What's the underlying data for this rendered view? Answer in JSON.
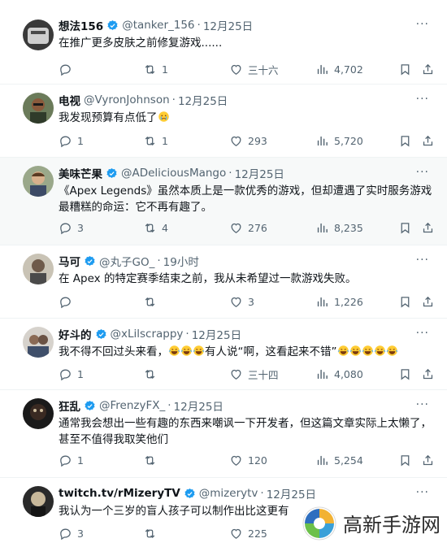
{
  "tweets": [
    {
      "name": "想法156",
      "handle": "@tanker_156",
      "time": "12月25日",
      "text": "在推广更多皮肤之前修复游戏......",
      "replies": "",
      "retweets": "1",
      "likes": "三十六",
      "views": "4,702",
      "verified": true
    },
    {
      "name": "电视",
      "handle": "@VyronJohnson",
      "time": "12月25日",
      "text": "我发现预算有点低了",
      "text_emoji": "crying-emoji",
      "replies": "1",
      "retweets": "1",
      "likes": "293",
      "views": "5,720",
      "verified": false
    },
    {
      "name": "美味芒果",
      "handle": "@ADeliciousMango",
      "time": "12月25日",
      "text": "《Apex Legends》虽然本质上是一款优秀的游戏，但却遭遇了实时服务游戏最糟糕的命运：它不再有趣了。",
      "replies": "3",
      "retweets": "4",
      "likes": "276",
      "views": "8,235",
      "verified": true
    },
    {
      "name": "马可",
      "handle": "@丸子GO_",
      "time": "19小时",
      "text": "在 Apex 的特定赛季结束之前，我从未希望过一款游戏失败。",
      "replies": "",
      "retweets": "",
      "likes": "3",
      "views": "1,226",
      "verified": true
    },
    {
      "name": "好斗的",
      "handle": "@xLilscrappy",
      "time": "12月25日",
      "text_parts": [
        "我不得不回过头来看，",
        "有人说“啊，这看起来不错”"
      ],
      "replies": "1",
      "retweets": "",
      "likes": "三十四",
      "views": "4,080",
      "verified": true
    },
    {
      "name": "狂乱",
      "handle": "@FrenzyFX_",
      "time": "12月25日",
      "text": "通常我会想出一些有趣的东西来嘲讽一下开发者，但这篇文章实际上太懒了，甚至不值得我取笑他们",
      "replies": "1",
      "retweets": "",
      "likes": "120",
      "views": "5,254",
      "verified": true
    },
    {
      "name": "twitch.tv/rMizeryTV",
      "handle": "@mizerytv",
      "time": "12月25日",
      "text": "我认为一个三岁的盲人孩子可以制作出比这更有",
      "replies": "3",
      "retweets": "",
      "likes": "225",
      "views": "",
      "verified": true
    }
  ],
  "more_label": "···",
  "watermark": {
    "text": "高新手游网"
  },
  "colors": {
    "verified": "#1d9bf0",
    "muted": "#536471",
    "divider": "#eff3f4"
  },
  "icons": {
    "reply": "reply-icon",
    "retweet": "retweet-icon",
    "like": "heart-icon",
    "views": "views-icon",
    "bookmark": "bookmark-icon",
    "share": "share-icon"
  }
}
